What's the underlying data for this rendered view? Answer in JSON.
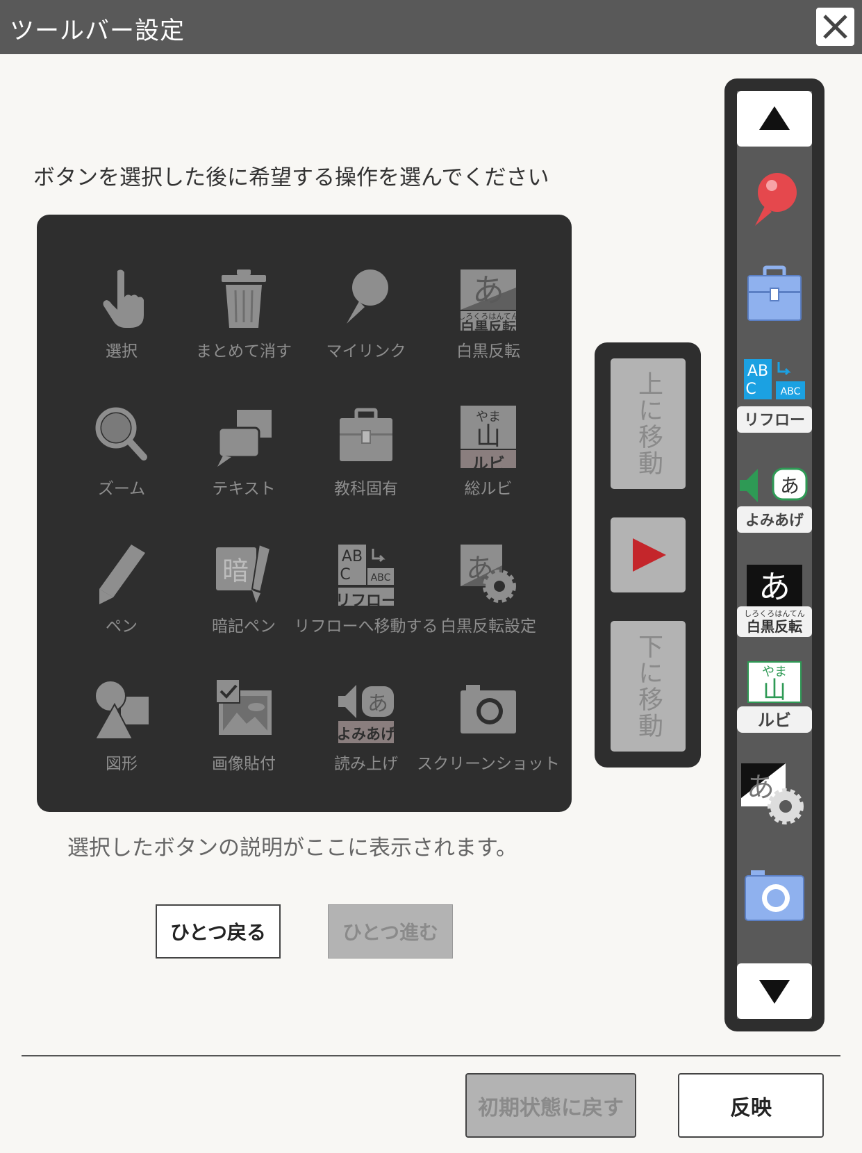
{
  "window": {
    "title": "ツールバー設定"
  },
  "instruction": "ボタンを選択した後に希望する操作を選んでください",
  "palette": {
    "tools": [
      {
        "label": "選択",
        "icon": "pointer-hand-icon"
      },
      {
        "label": "まとめて消す",
        "icon": "trash-icon"
      },
      {
        "label": "マイリンク",
        "icon": "pushpin-icon"
      },
      {
        "label": "白黒反転",
        "icon": "invert-colors-icon"
      },
      {
        "label": "ズーム",
        "icon": "magnifier-icon"
      },
      {
        "label": "テキスト",
        "icon": "speech-bubbles-icon"
      },
      {
        "label": "教科固有",
        "icon": "toolbox-icon"
      },
      {
        "label": "総ルビ",
        "icon": "ruby-icon"
      },
      {
        "label": "ペン",
        "icon": "pen-icon"
      },
      {
        "label": "暗記ペン",
        "icon": "memorize-pen-icon"
      },
      {
        "label": "リフローへ移動する",
        "icon": "reflow-icon"
      },
      {
        "label": "白黒反転設定",
        "icon": "invert-settings-icon"
      },
      {
        "label": "図形",
        "icon": "shapes-icon"
      },
      {
        "label": "画像貼付",
        "icon": "image-paste-icon"
      },
      {
        "label": "読み上げ",
        "icon": "read-aloud-icon"
      },
      {
        "label": "スクリーンショット",
        "icon": "camera-icon"
      }
    ],
    "icon_text": {
      "invert_glyph": "あ",
      "invert_ruby": "しろくろはんてん",
      "invert_caption": "白黒反転",
      "ruby_reading": "やま",
      "ruby_kanji": "山",
      "ruby_caption": "ルビ",
      "memo_glyph": "暗",
      "reflow_big": "AB",
      "reflow_c": "C",
      "reflow_small": "ABC",
      "reflow_caption": "リフロー",
      "read_glyph": "あ",
      "read_caption": "よみあげ"
    }
  },
  "description": "選択したボタンの説明がここに表示されます。",
  "history": {
    "undo_label": "ひとつ戻る",
    "redo_label": "ひとつ進む"
  },
  "move": {
    "up_label": "上に移動",
    "down_label": "下に移動"
  },
  "toolbar_preview": {
    "items": [
      "pushpin-icon",
      "toolbox-icon",
      "reflow-icon",
      "read-aloud-icon",
      "invert-colors-icon",
      "ruby-icon",
      "invert-settings-icon",
      "camera-icon"
    ]
  },
  "footer": {
    "reset_label": "初期状態に戻す",
    "apply_label": "反映"
  },
  "colors": {
    "titlebar": "#595959",
    "palette_bg": "#2e2e2e",
    "disabled_icon": "#8e8e8e",
    "play_red": "#c4262b",
    "pin_red": "#e5484d",
    "icon_blue": "#8fb1ee",
    "reflow_cyan": "#1ba1e2",
    "ruby_green": "#2e9a55"
  }
}
